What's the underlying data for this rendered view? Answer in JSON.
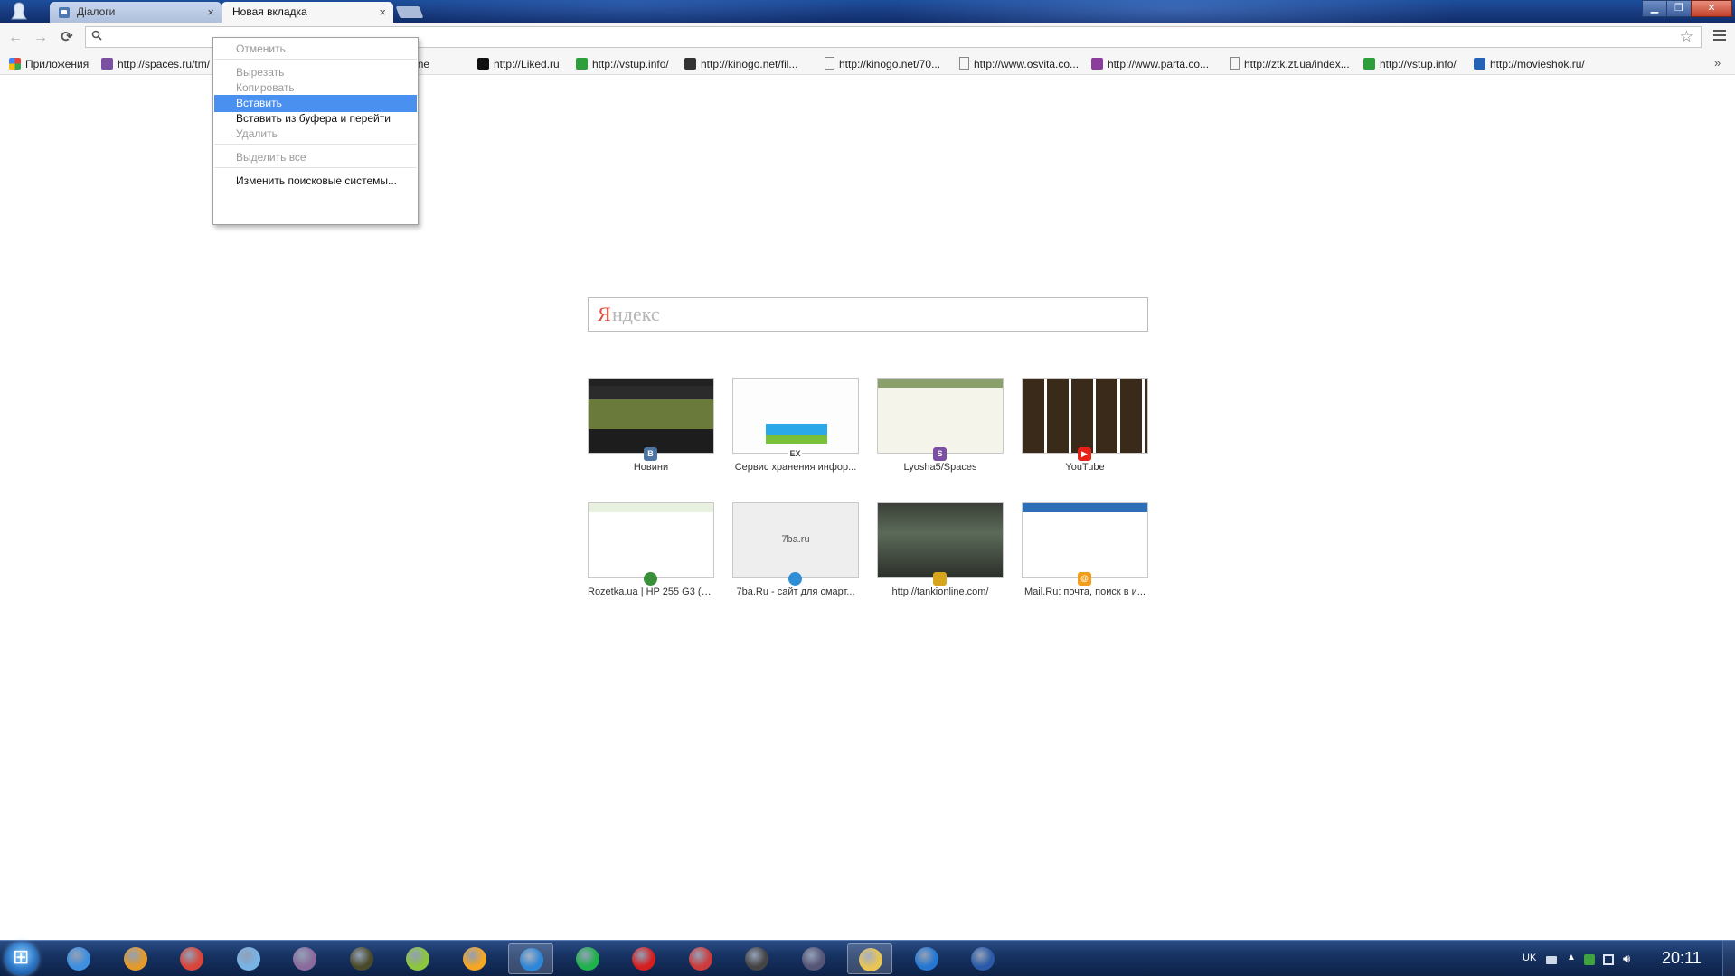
{
  "tabs": [
    {
      "label": "Діалоги"
    },
    {
      "label": "Новая вкладка"
    }
  ],
  "tab_close_glyph": "×",
  "toolbar": {
    "back_glyph": "←",
    "forward_glyph": "→",
    "reload_glyph": "⟳",
    "omnibox_value": "",
    "star_glyph": "☆"
  },
  "bookmarks": [
    {
      "label": "Приложения",
      "icon": "apps-grid-icon",
      "color": "#e94335"
    },
    {
      "label": "http://spaces.ru/tm/",
      "icon": "spaces-s-icon",
      "color": "#7b4fa2"
    },
    {
      "label": "ows phone",
      "icon": "",
      "color": ""
    },
    {
      "label": "http://Liked.ru",
      "icon": "liked-icon",
      "color": "#111111"
    },
    {
      "label": "http://vstup.info/",
      "icon": "vstup-icon",
      "color": "#2c9f3b"
    },
    {
      "label": "http://kinogo.net/fil...",
      "icon": "kinogo-icon",
      "color": "#333333"
    },
    {
      "label": "http://kinogo.net/70...",
      "icon": "page-icon",
      "color": "#ffffff"
    },
    {
      "label": "http://www.osvita.co...",
      "icon": "page-icon",
      "color": "#ffffff"
    },
    {
      "label": "http://www.parta.co...",
      "icon": "parta-icon",
      "color": "#8b3d9c"
    },
    {
      "label": "http://ztk.zt.ua/index...",
      "icon": "page-icon",
      "color": "#ffffff"
    },
    {
      "label": "http://vstup.info/",
      "icon": "vstup-icon",
      "color": "#2c9f3b"
    },
    {
      "label": "http://movieshok.ru/",
      "icon": "movieshok-icon",
      "color": "#2561b5"
    }
  ],
  "bookmarks_more": "»",
  "context_menu": {
    "items": [
      {
        "label": "Отменить",
        "disabled": true
      },
      {
        "label": "Вырезать",
        "disabled": true
      },
      {
        "label": "Копировать",
        "disabled": true
      },
      {
        "label": "Вставить",
        "selected": true
      },
      {
        "label": "Вставить из буфера и перейти",
        "disabled": false
      },
      {
        "label": "Удалить",
        "disabled": true
      },
      {
        "label": "Выделить все",
        "disabled": true
      },
      {
        "label": "Изменить поисковые системы...",
        "disabled": false
      }
    ]
  },
  "search": {
    "placeholder_first": "Я",
    "placeholder_rest": "ндекс"
  },
  "tiles": [
    {
      "title": "Новини",
      "icon": "vk-icon",
      "fav_color": "#4d76a3",
      "fav_text": "В"
    },
    {
      "title": "Сервис хранения инфор...",
      "icon": "ex-icon",
      "fav_color": "#ffffff",
      "fav_text": "EX"
    },
    {
      "title": "Lyosha5/Spaces",
      "icon": "spaces-s-icon",
      "fav_color": "#7b4fa2",
      "fav_text": "S"
    },
    {
      "title": "YouTube",
      "icon": "youtube-icon",
      "fav_color": "#e62117",
      "fav_text": "▶"
    },
    {
      "title": "Rozetka.ua | HP 255 G3 (K...",
      "icon": "rozetka-icon",
      "fav_color": "#3a8f3a",
      "fav_text": ""
    },
    {
      "title": "7ba.Ru - сайт для смарт...",
      "icon": "globe-icon",
      "fav_color": "#2f8fd6",
      "fav_text": "",
      "thumb_text": "7ba.ru"
    },
    {
      "title": "http://tankionline.com/",
      "icon": "tanki-icon",
      "fav_color": "#d7a51c",
      "fav_text": ""
    },
    {
      "title": "Mail.Ru: почта, поиск в и...",
      "icon": "mailru-icon",
      "fav_color": "#f39b1a",
      "fav_text": "@"
    }
  ],
  "taskbar": {
    "apps": [
      {
        "name": "ie-icon",
        "color": "#3d8fe0",
        "active": false
      },
      {
        "name": "dvd-maker-icon",
        "color": "#e39a2b",
        "active": false
      },
      {
        "name": "chrome-icon",
        "color": "#d9453a",
        "active": false
      },
      {
        "name": "notepad-icon",
        "color": "#78b3e6",
        "active": false
      },
      {
        "name": "media-player-icon",
        "color": "#8a6b9c",
        "active": false
      },
      {
        "name": "nfs-mw-icon",
        "color": "#4a4a2a",
        "active": false
      },
      {
        "name": "ball-icon",
        "color": "#8cc63e",
        "active": false
      },
      {
        "name": "aimp-icon",
        "color": "#f5a623",
        "active": false
      },
      {
        "name": "skype-like-icon",
        "color": "#2e86d6",
        "active": true
      },
      {
        "name": "a-icon",
        "color": "#1fb14b",
        "active": false
      },
      {
        "name": "opera-icon",
        "color": "#d41f1f",
        "active": false
      },
      {
        "name": "download-icon",
        "color": "#cc3b3b",
        "active": false
      },
      {
        "name": "battlefield-icon",
        "color": "#444444",
        "active": false
      },
      {
        "name": "phone-icon",
        "color": "#555577",
        "active": false
      },
      {
        "name": "explorer-icon",
        "color": "#e8c555",
        "active": true
      },
      {
        "name": "qip-icon",
        "color": "#2577d1",
        "active": false
      },
      {
        "name": "word-icon",
        "color": "#2a5aa8",
        "active": false
      }
    ],
    "lang": "UK",
    "time": "20:11"
  }
}
